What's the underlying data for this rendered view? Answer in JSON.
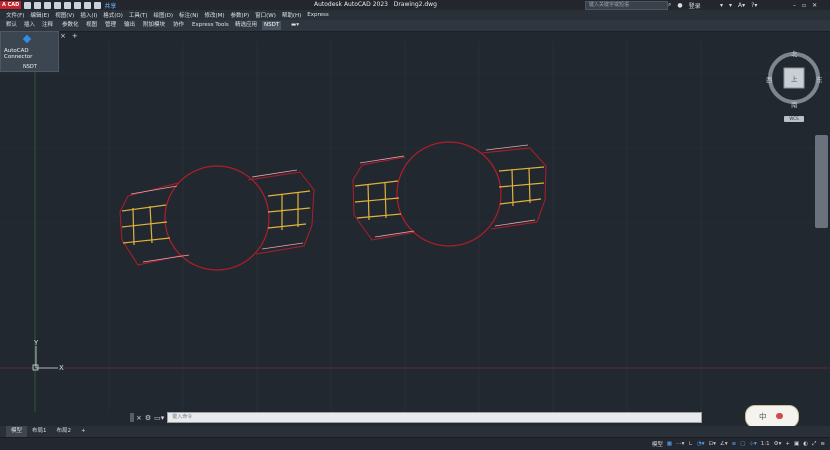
{
  "app": {
    "logo": "A CAD",
    "title": "Autodesk AutoCAD 2023",
    "drawing": "Drawing2.dwg",
    "share": "共享",
    "search_placeholder": "键入关键字或短语",
    "login": "登录"
  },
  "menu": [
    "文件(F)",
    "编辑(E)",
    "视图(V)",
    "插入(I)",
    "格式(O)",
    "工具(T)",
    "绘图(D)",
    "标注(N)",
    "修改(M)",
    "参数(P)",
    "窗口(W)",
    "帮助(H)",
    "Express"
  ],
  "ribbon_tabs": [
    "默认",
    "插入",
    "注释",
    "参数化",
    "视图",
    "管理",
    "输出",
    "附加模块",
    "协作",
    "Express Tools",
    "精选应用",
    "NSDT"
  ],
  "dropdown": {
    "item1": "AutoCAD Connector",
    "item2": "NSDT"
  },
  "viewcube": {
    "north": "北",
    "south": "南",
    "west": "西",
    "east": "东",
    "top": "上",
    "wcs": "WCS"
  },
  "ucs": {
    "x": "X",
    "y": "Y"
  },
  "command": {
    "placeholder": "键入命令"
  },
  "ime": {
    "label": "中"
  },
  "layout_tabs": [
    "模型",
    "布局1",
    "布局2"
  ],
  "status": {
    "model": "模型",
    "scale": "1:1"
  }
}
